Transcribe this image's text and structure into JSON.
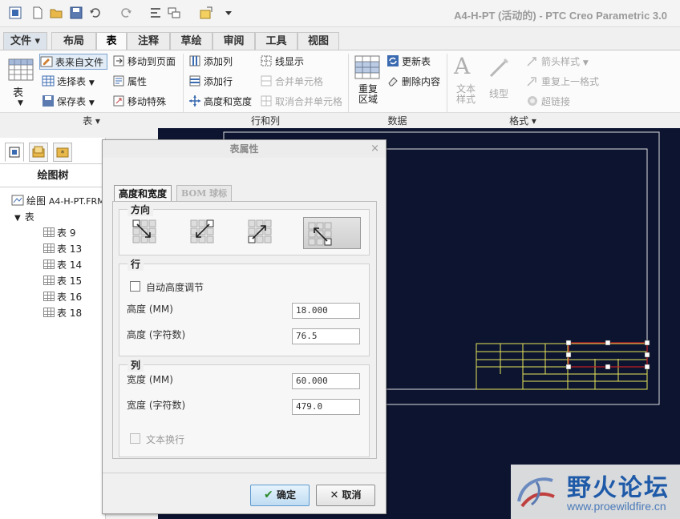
{
  "window": {
    "title": "A4-H-PT (活动的) - PTC Creo Parametric 3.0"
  },
  "tabs": [
    {
      "label": "文件 ▾"
    },
    {
      "label": "布局"
    },
    {
      "label": "表"
    },
    {
      "label": "注释"
    },
    {
      "label": "草绘"
    },
    {
      "label": "审阅"
    },
    {
      "label": "工具"
    },
    {
      "label": "视图"
    }
  ],
  "ribbon": {
    "table_big": "表",
    "table_from_file": "表来自文件",
    "move_to_page": "移动到页面",
    "select_table": "选择表",
    "properties": "属性",
    "save_table": "保存表",
    "move_special": "移动特殊",
    "add_column": "添加列",
    "line_display": "线显示",
    "add_row": "添加行",
    "merge_cells": "合并单元格",
    "height_width": "高度和宽度",
    "unmerge_cells": "取消合并单元格",
    "repeat_region": "重复区域",
    "update_table": "更新表",
    "delete_content": "删除内容",
    "text_style": "文本样式",
    "line_style": "线型",
    "arrow_style": "箭头样式",
    "repeat_last_format": "重复上一格式",
    "hyperlink": "超链接",
    "groups": {
      "table": "表 ▾",
      "rows_cols": "行和列",
      "data": "数据",
      "format": "格式 ▾"
    }
  },
  "left_panel": {
    "title": "绘图树",
    "drawing_prefix": "绘图",
    "drawing_name": "A4-H-PT.FRM",
    "tables_node": "表",
    "tables": [
      {
        "label": "表 9"
      },
      {
        "label": "表 13"
      },
      {
        "label": "表 14"
      },
      {
        "label": "表 15"
      },
      {
        "label": "表 16"
      },
      {
        "label": "表 18"
      }
    ]
  },
  "dialog": {
    "title": "表属性",
    "close": "×",
    "tab_height_width": "高度和宽度",
    "tab_bom": "BOM 球标",
    "direction_label": "方向",
    "row_label": "行",
    "auto_height": "自动高度调节",
    "row_height_mm_label": "高度 (MM)",
    "row_height_mm": "18.000",
    "row_height_chars_label": "高度 (字符数)",
    "row_height_chars": "76.5",
    "col_label": "列",
    "col_width_mm_label": "宽度 (MM)",
    "col_width_mm": "60.000",
    "col_width_chars_label": "宽度 (字符数)",
    "col_width_chars": "479.0",
    "text_wrap": "文本换行",
    "ok": "确定",
    "cancel": "取消"
  },
  "watermark": {
    "name": "野火论坛",
    "url": "www.proewildfire.cn"
  },
  "colors": {
    "canvas": "#0c1430",
    "table_lines": "#e8e85a",
    "frame": "#e0e0e0",
    "selection": "#cc2020",
    "ok_button": "#cfe6f7"
  }
}
